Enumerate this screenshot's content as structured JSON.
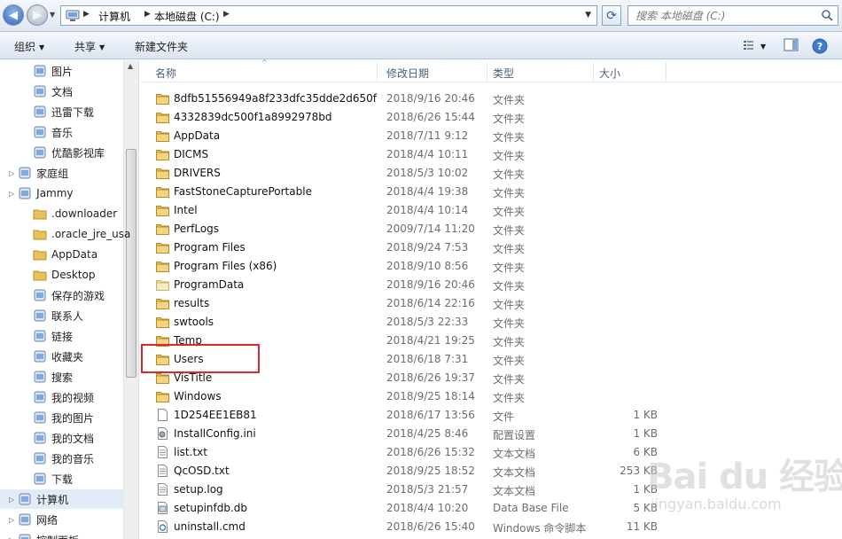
{
  "address": {
    "breadcrumbs": [
      "计算机",
      "本地磁盘 (C:)"
    ],
    "search_placeholder": "搜索 本地磁盘 (C:)"
  },
  "toolbar": {
    "organize": "组织",
    "share": "共享",
    "new_folder": "新建文件夹"
  },
  "nav": {
    "items": [
      {
        "label": "图片",
        "icon": "pictures-icon",
        "indent": 1
      },
      {
        "label": "文档",
        "icon": "documents-icon",
        "indent": 1
      },
      {
        "label": "迅雷下载",
        "icon": "thunder-download-icon",
        "indent": 1
      },
      {
        "label": "音乐",
        "icon": "music-icon",
        "indent": 1
      },
      {
        "label": "优酷影视库",
        "icon": "youku-library-icon",
        "indent": 1
      },
      {
        "label": "家庭组",
        "icon": "homegroup-icon",
        "indent": 0
      },
      {
        "label": "Jammy",
        "icon": "user-folder-icon",
        "indent": 0
      },
      {
        "label": ".downloader",
        "icon": "folder-icon",
        "indent": 1
      },
      {
        "label": ".oracle_jre_usa",
        "icon": "folder-icon",
        "indent": 1
      },
      {
        "label": "AppData",
        "icon": "folder-icon",
        "indent": 1
      },
      {
        "label": "Desktop",
        "icon": "folder-icon",
        "indent": 1
      },
      {
        "label": "保存的游戏",
        "icon": "saved-games-icon",
        "indent": 1
      },
      {
        "label": "联系人",
        "icon": "contacts-icon",
        "indent": 1
      },
      {
        "label": "链接",
        "icon": "links-icon",
        "indent": 1
      },
      {
        "label": "收藏夹",
        "icon": "favorites-icon",
        "indent": 1
      },
      {
        "label": "搜索",
        "icon": "searches-icon",
        "indent": 1
      },
      {
        "label": "我的视频",
        "icon": "videos-folder-icon",
        "indent": 1
      },
      {
        "label": "我的图片",
        "icon": "pictures-folder-icon",
        "indent": 1
      },
      {
        "label": "我的文档",
        "icon": "documents-folder-icon",
        "indent": 1
      },
      {
        "label": "我的音乐",
        "icon": "music-folder-icon",
        "indent": 1
      },
      {
        "label": "下载",
        "icon": "downloads-icon",
        "indent": 1
      },
      {
        "label": "计算机",
        "icon": "computer-icon",
        "indent": 0,
        "selected": true
      },
      {
        "label": "网络",
        "icon": "network-icon",
        "indent": 0
      },
      {
        "label": "控制面板",
        "icon": "control-panel-icon",
        "indent": 0
      }
    ]
  },
  "columns": {
    "name": "名称",
    "date": "修改日期",
    "type": "类型",
    "size": "大小"
  },
  "files": [
    {
      "name": "8dfb51556949a8f233dfc35dde2d650f",
      "date": "2018/9/16 20:46",
      "type": "文件夹",
      "size": "",
      "icon": "folder"
    },
    {
      "name": "4332839dc500f1a8992978bd",
      "date": "2018/6/26 15:44",
      "type": "文件夹",
      "size": "",
      "icon": "folder"
    },
    {
      "name": "AppData",
      "date": "2018/7/11 9:12",
      "type": "文件夹",
      "size": "",
      "icon": "folder"
    },
    {
      "name": "DICMS",
      "date": "2018/4/4 10:11",
      "type": "文件夹",
      "size": "",
      "icon": "folder"
    },
    {
      "name": "DRIVERS",
      "date": "2018/5/3 10:02",
      "type": "文件夹",
      "size": "",
      "icon": "folder"
    },
    {
      "name": "FastStoneCapturePortable",
      "date": "2018/4/4 19:38",
      "type": "文件夹",
      "size": "",
      "icon": "folder"
    },
    {
      "name": "Intel",
      "date": "2018/4/4 10:14",
      "type": "文件夹",
      "size": "",
      "icon": "folder"
    },
    {
      "name": "PerfLogs",
      "date": "2009/7/14 11:20",
      "type": "文件夹",
      "size": "",
      "icon": "folder"
    },
    {
      "name": "Program Files",
      "date": "2018/9/24 7:53",
      "type": "文件夹",
      "size": "",
      "icon": "folder"
    },
    {
      "name": "Program Files (x86)",
      "date": "2018/9/10 8:56",
      "type": "文件夹",
      "size": "",
      "icon": "folder"
    },
    {
      "name": "ProgramData",
      "date": "2018/9/16 20:46",
      "type": "文件夹",
      "size": "",
      "icon": "folder-light"
    },
    {
      "name": "results",
      "date": "2018/6/14 22:16",
      "type": "文件夹",
      "size": "",
      "icon": "folder"
    },
    {
      "name": "swtools",
      "date": "2018/5/3 22:33",
      "type": "文件夹",
      "size": "",
      "icon": "folder"
    },
    {
      "name": "Temp",
      "date": "2018/4/21 19:25",
      "type": "文件夹",
      "size": "",
      "icon": "folder"
    },
    {
      "name": "Users",
      "date": "2018/6/18 7:31",
      "type": "文件夹",
      "size": "",
      "icon": "folder"
    },
    {
      "name": "VisTitle",
      "date": "2018/6/26 19:37",
      "type": "文件夹",
      "size": "",
      "icon": "folder"
    },
    {
      "name": "Windows",
      "date": "2018/9/25 18:14",
      "type": "文件夹",
      "size": "",
      "icon": "folder"
    },
    {
      "name": "1D254EE1EB81",
      "date": "2018/6/17 13:56",
      "type": "文件",
      "size": "1 KB",
      "icon": "file"
    },
    {
      "name": "InstallConfig.ini",
      "date": "2018/4/25 8:46",
      "type": "配置设置",
      "size": "1 KB",
      "icon": "ini"
    },
    {
      "name": "list.txt",
      "date": "2018/6/26 15:32",
      "type": "文本文档",
      "size": "6 KB",
      "icon": "text"
    },
    {
      "name": "QcOSD.txt",
      "date": "2018/9/25 18:52",
      "type": "文本文档",
      "size": "253 KB",
      "icon": "text"
    },
    {
      "name": "setup.log",
      "date": "2018/5/3 21:57",
      "type": "文本文档",
      "size": "1 KB",
      "icon": "text"
    },
    {
      "name": "setupinfdb.db",
      "date": "2018/4/4 10:20",
      "type": "Data Base File",
      "size": "5 KB",
      "icon": "db"
    },
    {
      "name": "uninstall.cmd",
      "date": "2018/6/26 15:40",
      "type": "Windows 命令脚本",
      "size": "11 KB",
      "icon": "cmd"
    }
  ],
  "highlighted_file": "Users",
  "watermark": {
    "logo": "Bai du 经验",
    "url": "jingyan.baidu.com"
  },
  "colors": {
    "highlight_box": "#e0262b",
    "folder": "#e8c15a",
    "selection": "#e2ecf8"
  }
}
